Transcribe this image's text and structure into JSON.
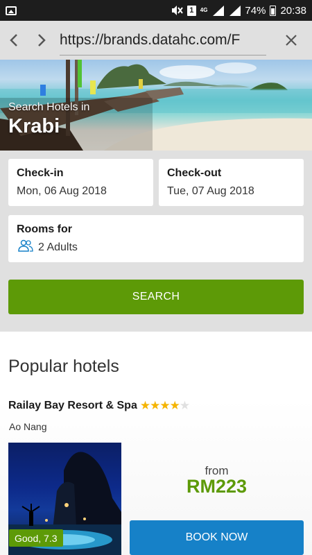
{
  "status_bar": {
    "battery": "74%",
    "time": "20:38",
    "sim_label": "1",
    "network": "4G"
  },
  "browser": {
    "url": "https://brands.datahc.com/F"
  },
  "hero": {
    "subtitle": "Search Hotels in",
    "city": "Krabi"
  },
  "search_form": {
    "checkin_label": "Check-in",
    "checkin_value": "Mon, 06 Aug 2018",
    "checkout_label": "Check-out",
    "checkout_value": "Tue, 07 Aug 2018",
    "rooms_label": "Rooms for",
    "rooms_value": "2 Adults",
    "search_button": "SEARCH"
  },
  "popular": {
    "title": "Popular hotels",
    "hotels": [
      {
        "name": "Railay Bay Resort & Spa",
        "stars": 4,
        "max_stars": 5,
        "area": "Ao Nang",
        "rating": "Good, 7.3",
        "from_label": "from",
        "price": "RM223",
        "book_label": "BOOK NOW"
      }
    ]
  },
  "colors": {
    "accent_green": "#5d9a07",
    "book_blue": "#1681c8",
    "star": "#f5b400"
  }
}
